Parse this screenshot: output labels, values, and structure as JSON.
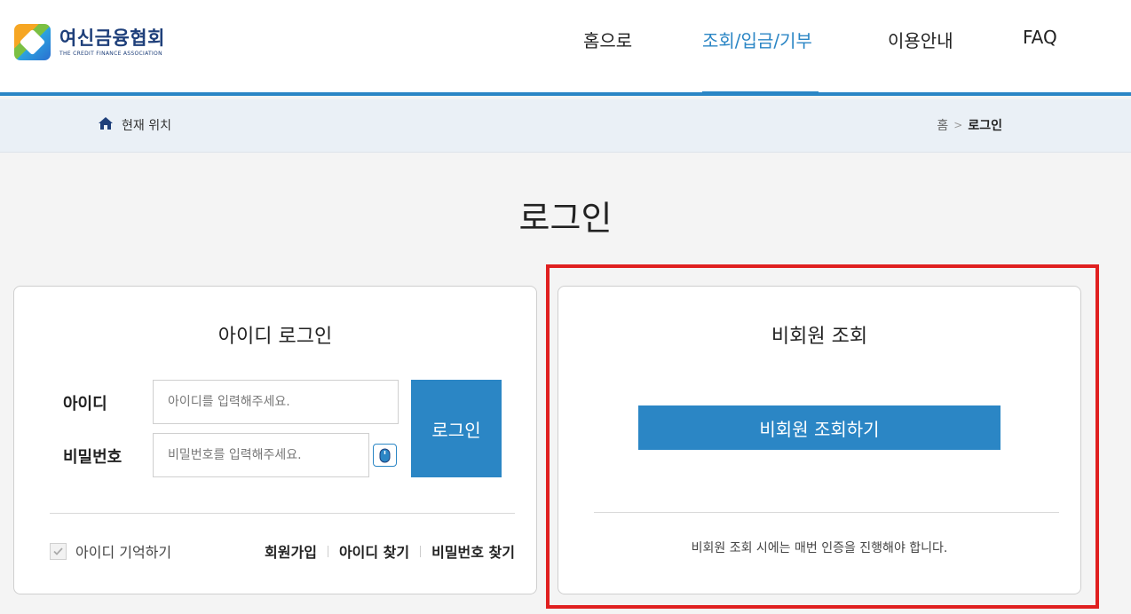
{
  "header": {
    "logo_name": "여신금융협회",
    "logo_sub": "THE CREDIT FINANCE ASSOCIATION",
    "nav": [
      "홈으로",
      "조회/입금/기부",
      "이용안내",
      "FAQ"
    ],
    "active_nav": "조회/입금/기부"
  },
  "location": {
    "label": "현재 위치",
    "crumb_home": "홈",
    "crumb_sep": ">",
    "crumb_current": "로그인"
  },
  "page_title": "로그인",
  "id_login": {
    "title": "아이디 로그인",
    "id_label": "아이디",
    "id_placeholder": "아이디를 입력해주세요.",
    "pw_label": "비밀번호",
    "pw_placeholder": "비밀번호를 입력해주세요.",
    "login_button": "로그인",
    "remember_label": "아이디 기억하기",
    "links": [
      "회원가입",
      "아이디 찾기",
      "비밀번호 찾기"
    ]
  },
  "guest": {
    "title": "비회원 조회",
    "button": "비회원 조회하기",
    "note": "비회원 조회 시에는 매번 인증을 진행해야 합니다."
  },
  "colors": {
    "accent": "#2b86c5",
    "highlight": "#e02020",
    "logo_navy": "#1e3f7a"
  }
}
